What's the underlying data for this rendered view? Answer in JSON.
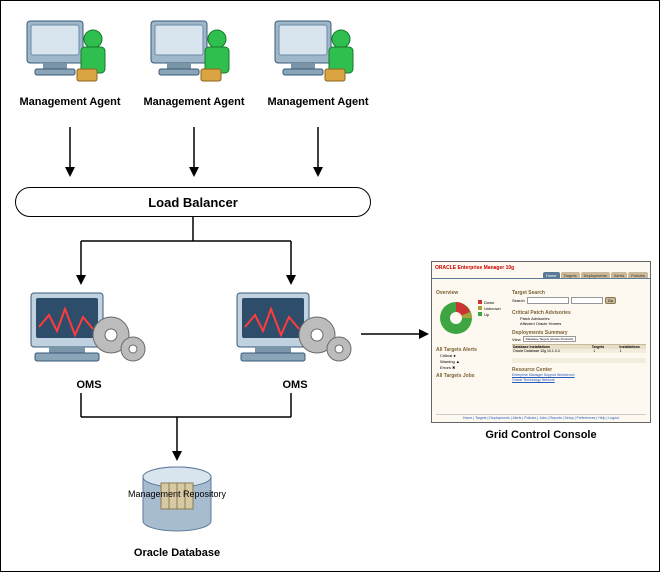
{
  "labels": {
    "agent": "Management Agent",
    "load_balancer": "Load Balancer",
    "oms": "OMS",
    "repository": "Management Repository",
    "database": "Oracle Database",
    "console": "Grid Control Console"
  },
  "console_ui": {
    "brand": "ORACLE Enterprise Manager 10g",
    "tabs": [
      "Home",
      "Targets",
      "Deployments",
      "Alerts",
      "Policies"
    ],
    "overview_title": "Overview",
    "target_search_title": "Target Search",
    "search_label": "Search",
    "go_label": "Go",
    "status_legend": [
      "Up",
      "Down",
      "Unknown"
    ],
    "all_targets_alerts": "All Targets Alerts",
    "critical": "Critical",
    "warning": "Warning",
    "errors": "Errors",
    "jobs_title": "All Targets Jobs",
    "deploy_title": "Deployments Summary",
    "view_label": "View",
    "view_option": "Database Targets (Oracle Products)",
    "col_db": "Database Installations",
    "col_targets": "Targets",
    "col_count": "Installations",
    "row_ora10": "Oracle Database 10g 10.1.0.4",
    "resource_center": "Resource Center",
    "patch_advisory": "Critical Patch Advisories",
    "patch_label": "Patch Advisories",
    "affected_homes": "Affected Oracle Homes",
    "footer": "Home | Targets | Deployments | Alerts | Policies | Jobs | Reports | Setup | Preferences | Help | Logout"
  }
}
